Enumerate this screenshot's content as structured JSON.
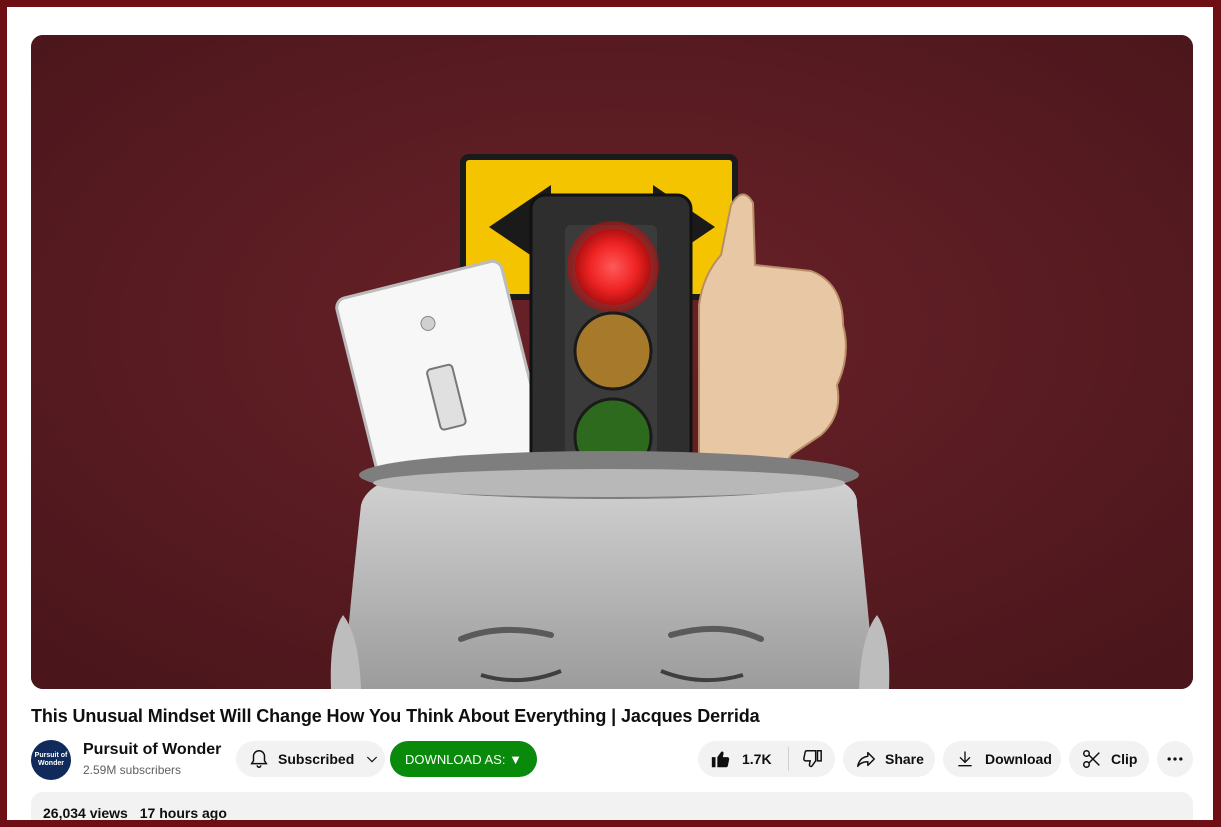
{
  "video": {
    "title": "This Unusual Mindset Will Change How You Think About Everything | Jacques Derrida",
    "thumbnail_description": "player-thumbnail"
  },
  "channel": {
    "avatar_text": "Pursuit of Wonder",
    "name": "Pursuit of Wonder",
    "subscribers": "2.59M subscribers"
  },
  "actions": {
    "subscribed_label": "Subscribed",
    "download_as_label": "DOWNLOAD AS: ▼",
    "like_count": "1.7K",
    "share_label": "Share",
    "download_label": "Download",
    "clip_label": "Clip"
  },
  "description": {
    "views": "26,034 views",
    "time_ago": "17 hours ago"
  },
  "colors": {
    "page_border": "#6e0f16",
    "thumbnail_bg": "#5a1c22",
    "download_as_bg": "#0a8a0a",
    "pill_bg": "#f2f2f2"
  },
  "icons": [
    "bell-icon",
    "chevron-down-icon",
    "thumbs-up-icon",
    "thumbs-down-icon",
    "share-icon",
    "download-icon",
    "scissors-icon",
    "more-icon"
  ]
}
